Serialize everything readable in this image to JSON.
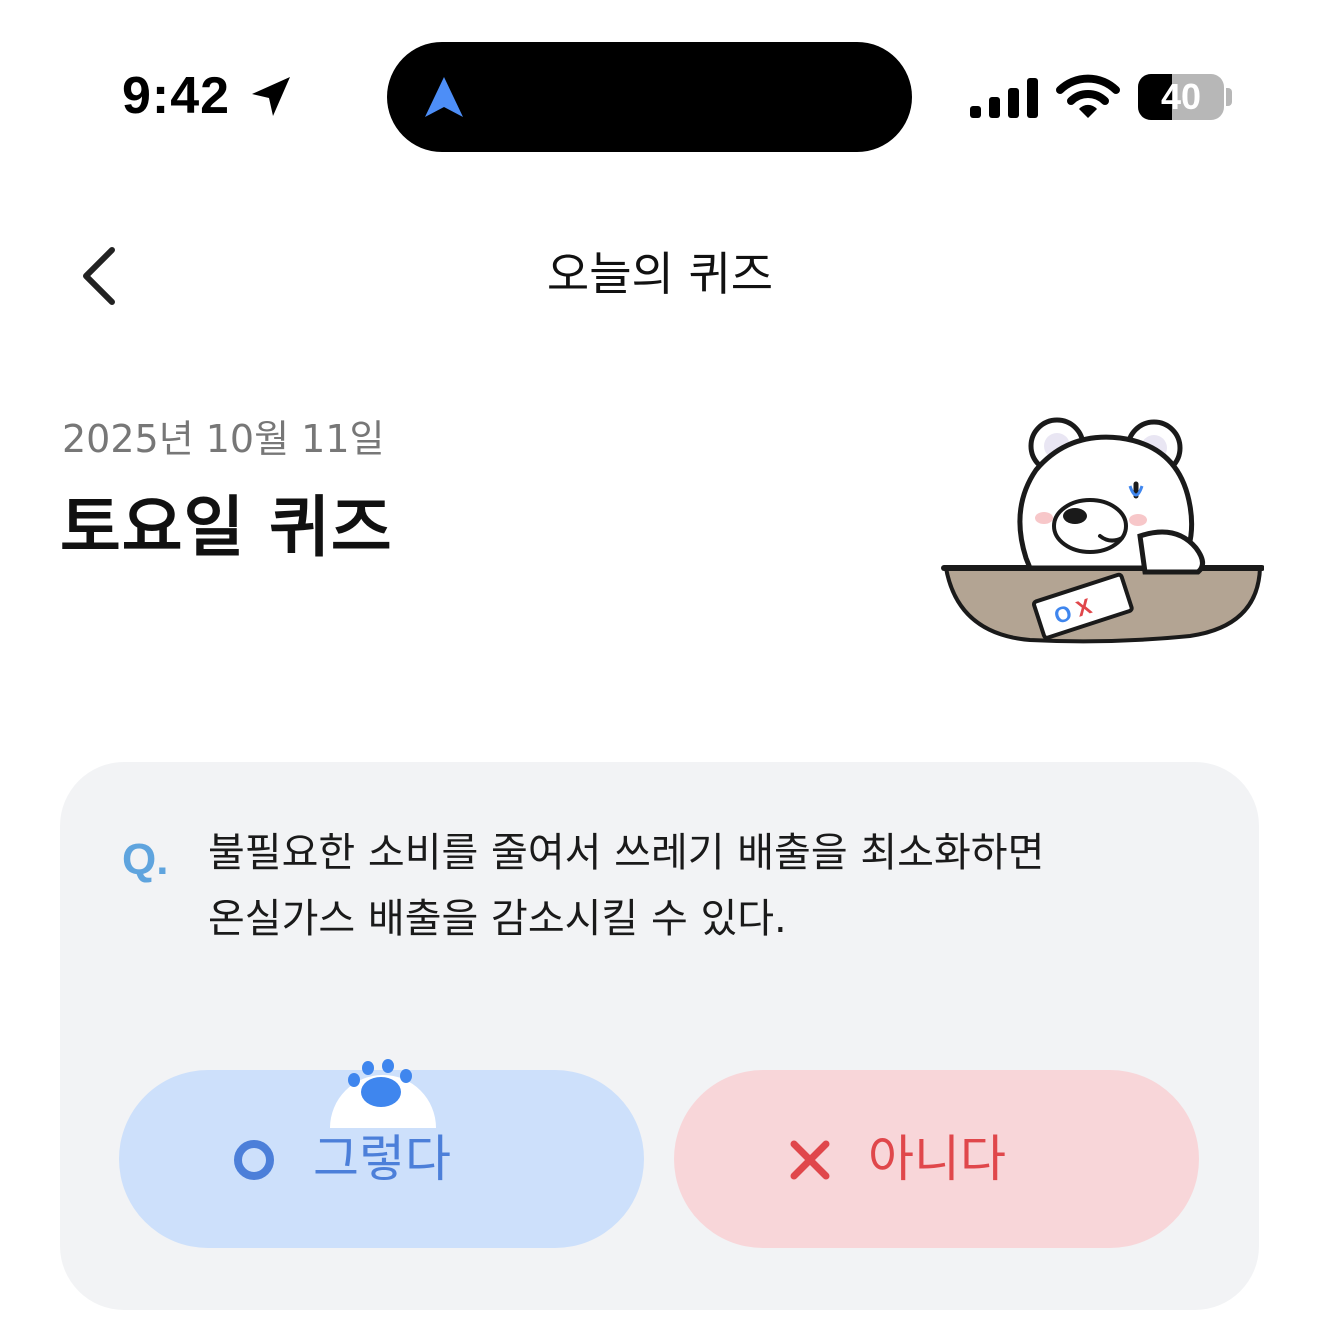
{
  "status_bar": {
    "time": "9:42",
    "battery_level": "40",
    "battery_fraction": 0.4
  },
  "nav": {
    "title": "오늘의 퀴즈"
  },
  "header": {
    "date": "2025년 10월 11일",
    "title": "토요일 퀴즈"
  },
  "question": {
    "marker": "Q.",
    "text_line1": "불필요한 소비를 줄여서 쓰레기 배출을 최소화하면",
    "text_line2": "온실가스 배출을 감소시킬 수 있다."
  },
  "answers": {
    "yes_label": "그렇다",
    "no_label": "아니다"
  },
  "illustration": {
    "paper_marks": "OX"
  },
  "colors": {
    "yes_bg": "#cde0fb",
    "yes_fg": "#4c7fd9",
    "no_bg": "#f8d6d9",
    "no_fg": "#e0474b",
    "card_bg": "#f2f3f5",
    "q_marker": "#5fa4de",
    "paw": "#3f86ee"
  },
  "icons": {
    "location": "location-arrow-icon",
    "island": "navigation-icon",
    "signal": "cellular-signal-icon",
    "wifi": "wifi-icon",
    "battery": "battery-icon",
    "back": "chevron-left-icon",
    "yes": "circle-o-icon",
    "no": "x-mark-icon",
    "paw": "paw-icon"
  }
}
